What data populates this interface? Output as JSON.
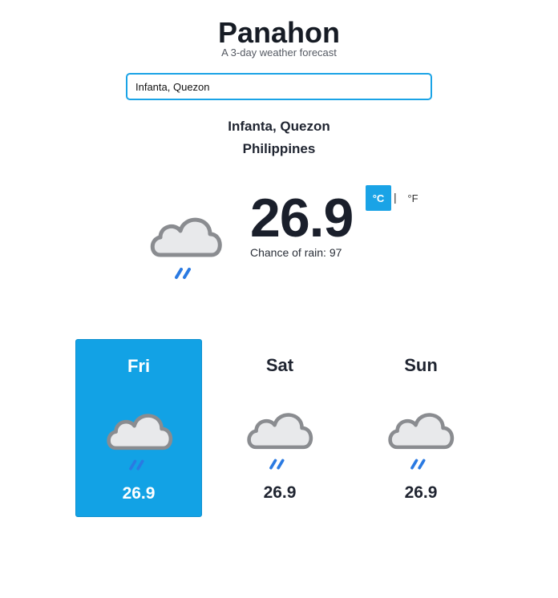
{
  "app": {
    "title": "Panahon",
    "subtitle": "A 3-day weather forecast"
  },
  "search": {
    "value": "Infanta, Quezon",
    "placeholder": ""
  },
  "location": {
    "name": "Infanta, Quezon",
    "country": "Philippines"
  },
  "current": {
    "temperature": "26.9",
    "icon": "rain-cloud-icon",
    "rain_label": "Chance of rain: 97"
  },
  "units": {
    "celsius_label": "°C",
    "separator": "|",
    "fahrenheit_label": "°F",
    "selected": "celsius"
  },
  "forecast": [
    {
      "day": "Fri",
      "temperature": "26.9",
      "icon": "rain-cloud-icon",
      "selected": true
    },
    {
      "day": "Sat",
      "temperature": "26.9",
      "icon": "rain-cloud-icon",
      "selected": false
    },
    {
      "day": "Sun",
      "temperature": "26.9",
      "icon": "rain-cloud-icon",
      "selected": false
    }
  ],
  "colors": {
    "accent": "#12a2e5",
    "rain_drops": "#2a7ae2",
    "cloud_fill": "#e8e9eb",
    "cloud_outline": "#8a8c90"
  }
}
